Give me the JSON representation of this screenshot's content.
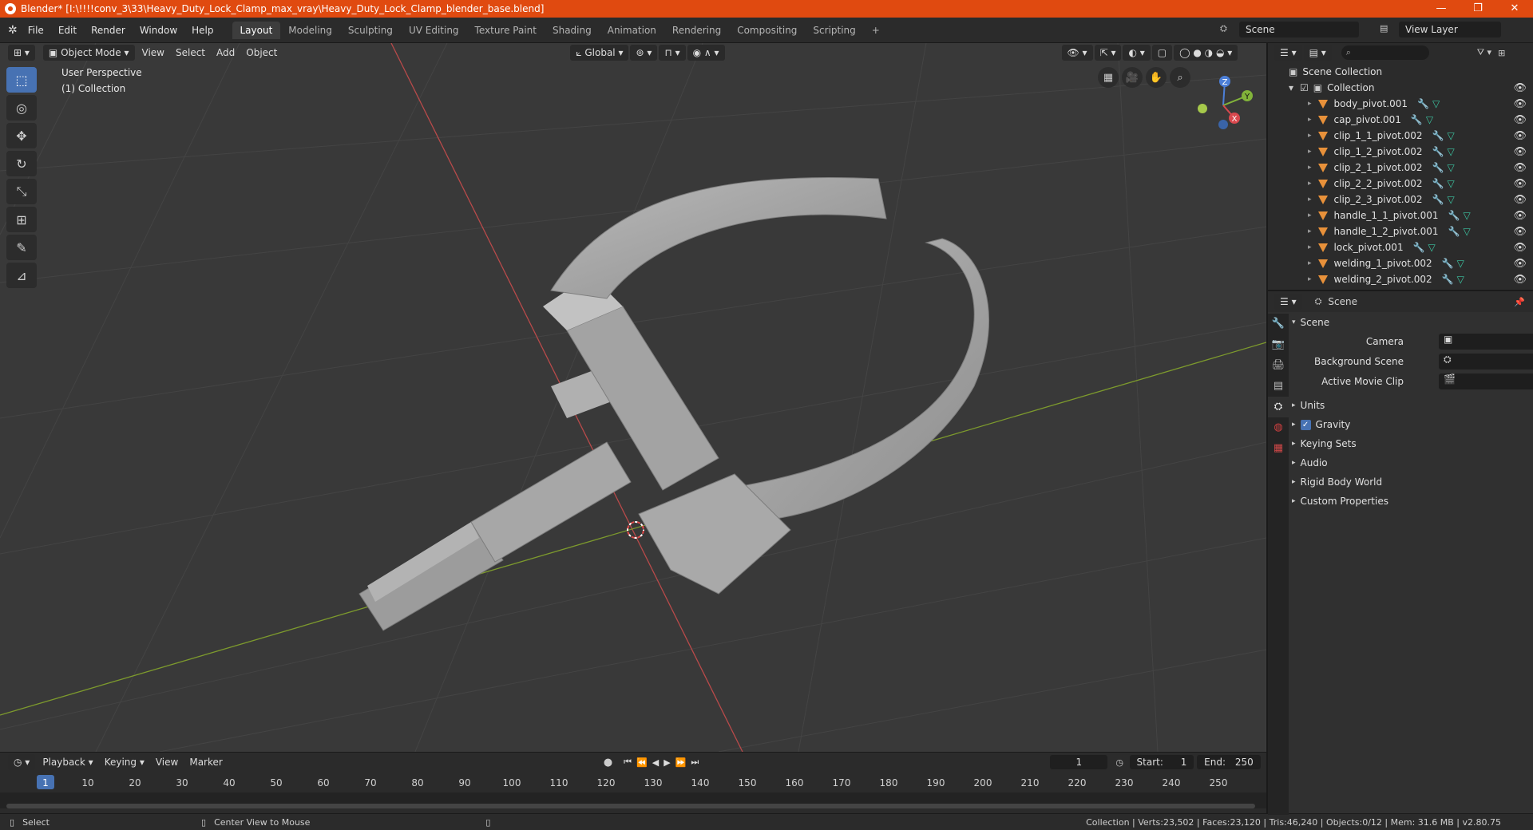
{
  "window": {
    "title": "Blender* [I:\\!!!!conv_3\\33\\Heavy_Duty_Lock_Clamp_max_vray\\Heavy_Duty_Lock_Clamp_blender_base.blend]",
    "minimize": "—",
    "restore": "❐",
    "close": "✕"
  },
  "menu": [
    "File",
    "Edit",
    "Render",
    "Window",
    "Help"
  ],
  "workspaces": [
    "Layout",
    "Modeling",
    "Sculpting",
    "UV Editing",
    "Texture Paint",
    "Shading",
    "Animation",
    "Rendering",
    "Compositing",
    "Scripting"
  ],
  "active_workspace": "Layout",
  "add_workspace": "+",
  "scene_selector": "Scene",
  "view_layer_selector": "View Layer",
  "viewport": {
    "mode": "Object Mode",
    "menus": [
      "View",
      "Select",
      "Add",
      "Object"
    ],
    "transform_orientation": "Global",
    "overlay_title": "User Perspective",
    "overlay_collection": "(1) Collection",
    "axes": {
      "x": "X",
      "y": "Y",
      "z": "Z"
    }
  },
  "tools": [
    {
      "name": "select-box-tool",
      "glyph": "⬚"
    },
    {
      "name": "cursor-tool",
      "glyph": "◎"
    },
    {
      "name": "move-tool",
      "glyph": "✥"
    },
    {
      "name": "rotate-tool",
      "glyph": "↻"
    },
    {
      "name": "scale-tool",
      "glyph": "⤡"
    },
    {
      "name": "transform-tool",
      "glyph": "⊞"
    },
    {
      "name": "annotate-tool",
      "glyph": "✎"
    },
    {
      "name": "measure-tool",
      "glyph": "📐"
    }
  ],
  "timeline": {
    "menus": [
      "Playback",
      "Keying",
      "View",
      "Marker"
    ],
    "current_frame": "1",
    "start_label": "Start:",
    "start": "1",
    "end_label": "End:",
    "end": "250",
    "ruler": [
      "1",
      "10",
      "20",
      "30",
      "40",
      "50",
      "60",
      "70",
      "80",
      "90",
      "100",
      "110",
      "120",
      "130",
      "140",
      "150",
      "160",
      "170",
      "180",
      "190",
      "200",
      "210",
      "220",
      "230",
      "240",
      "250"
    ]
  },
  "statusbar": {
    "left": "Select",
    "middle": "Center View to Mouse",
    "right": "Collection | Verts:23,502 | Faces:23,120 | Tris:46,240 | Objects:0/12 | Mem: 31.6 MB | v2.80.75"
  },
  "outliner": {
    "root": "Scene Collection",
    "collection": "Collection",
    "objects": [
      "body_pivot.001",
      "cap_pivot.001",
      "clip_1_1_pivot.002",
      "clip_1_2_pivot.002",
      "clip_2_1_pivot.002",
      "clip_2_2_pivot.002",
      "clip_2_3_pivot.002",
      "handle_1_1_pivot.001",
      "handle_1_2_pivot.001",
      "lock_pivot.001",
      "welding_1_pivot.002",
      "welding_2_pivot.002"
    ]
  },
  "properties": {
    "context": "Scene",
    "panel": "Scene",
    "camera_label": "Camera",
    "background_scene_label": "Background Scene",
    "active_movie_clip_label": "Active Movie Clip",
    "subpanels": [
      "Units",
      "Gravity",
      "Keying Sets",
      "Audio",
      "Rigid Body World",
      "Custom Properties"
    ]
  }
}
